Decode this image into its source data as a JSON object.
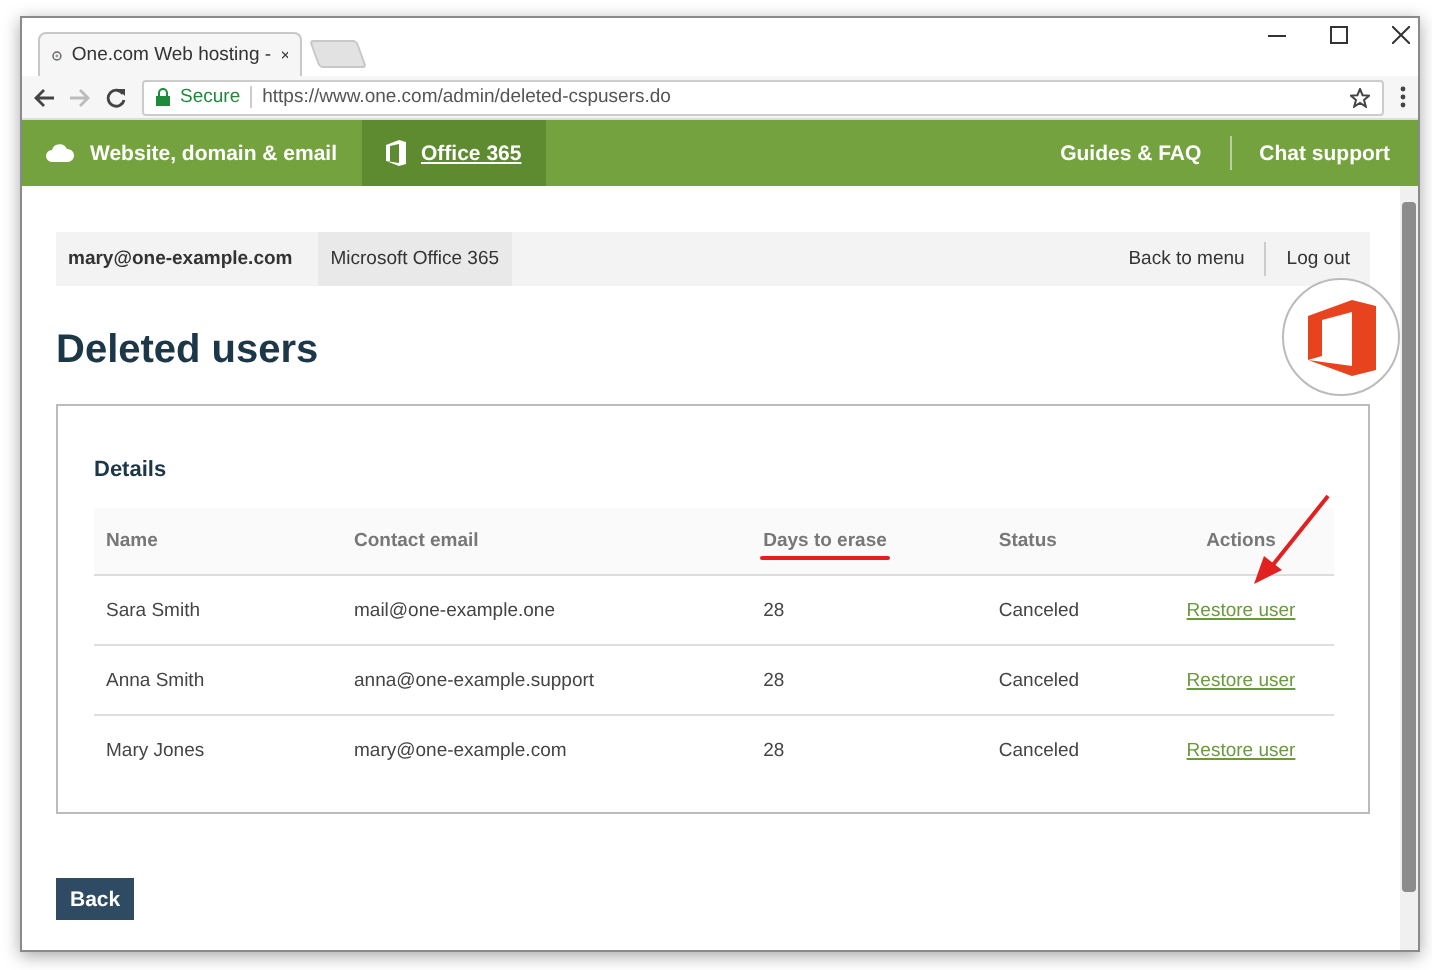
{
  "browser": {
    "tab_title": "One.com Web hosting -",
    "security": "Secure",
    "url": "https://www.one.com/admin/deleted-cspusers.do"
  },
  "nav": {
    "items": [
      {
        "label": "Website, domain & email",
        "kind": "cloud",
        "selected": false
      },
      {
        "label": "Office 365",
        "kind": "office",
        "selected": true
      }
    ],
    "links": [
      "Guides & FAQ",
      "Chat support"
    ]
  },
  "account_bar": {
    "email": "mary@one-example.com",
    "product": "Microsoft Office 365",
    "links": [
      "Back to menu",
      "Log out"
    ]
  },
  "page_title": "Deleted users",
  "details": {
    "title": "Details",
    "columns": [
      {
        "label": "Name",
        "marked": false
      },
      {
        "label": "Contact email",
        "marked": false
      },
      {
        "label": "Days to erase",
        "marked": true
      },
      {
        "label": "Status",
        "marked": false
      },
      {
        "label": "Actions",
        "marked": false
      }
    ],
    "rows": [
      {
        "name": "Sara Smith",
        "email": "mail@one-example.one",
        "days": "28",
        "status": "Canceled",
        "action": "Restore user",
        "pointed": true
      },
      {
        "name": "Anna Smith",
        "email": "anna@one-example.support",
        "days": "28",
        "status": "Canceled",
        "action": "Restore user",
        "pointed": false
      },
      {
        "name": "Mary Jones",
        "email": "mary@one-example.com",
        "days": "28",
        "status": "Canceled",
        "action": "Restore user",
        "pointed": false
      }
    ]
  },
  "back_button": "Back"
}
